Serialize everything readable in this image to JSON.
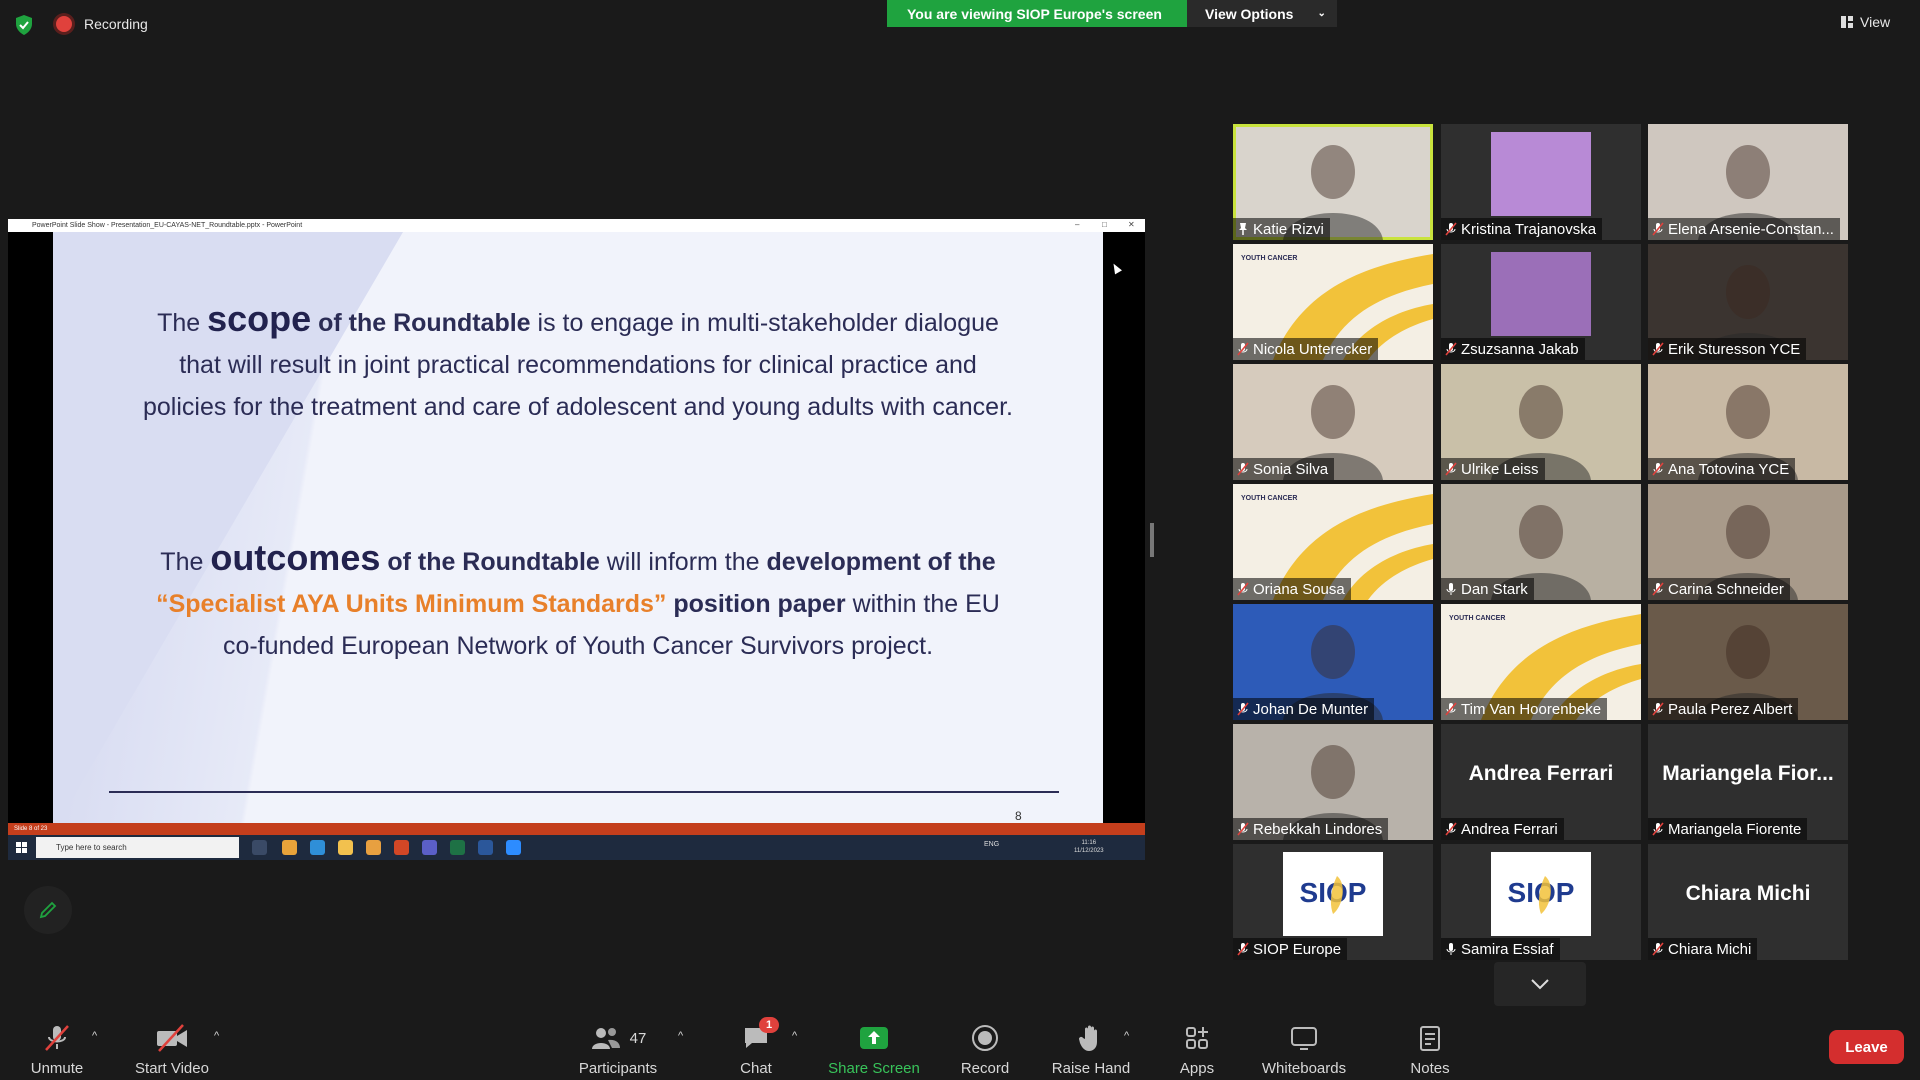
{
  "topbar": {
    "recording_label": "Recording",
    "share_banner": "You are viewing SIOP Europe's screen",
    "view_options": "View Options",
    "view_label": "View"
  },
  "shared_screen": {
    "window_title": "PowerPoint Slide Show  -  Presentation_EU-CAYAS-NET_Roundtable.pptx  -  PowerPoint",
    "status_bar": "Slide 8 of 23",
    "taskbar_search_placeholder": "Type here to search",
    "tray_lang": "ENG",
    "clock_time": "11:16",
    "clock_date": "11/12/2023",
    "slide": {
      "p1_a": "The ",
      "p1_big": "scope",
      "p1_b": " of the Roundtable",
      "p1_c": " is to engage in multi-stakeholder dialogue that will result in joint practical recommendations for clinical practice and policies for the treatment and care of adolescent and young adults with cancer.",
      "p2_a": "The ",
      "p2_big": "outcomes",
      "p2_b": " of the Roundtable",
      "p2_c": " will inform the ",
      "p2_d": "development of the",
      "p2_orange": "“Specialist AYA Units Minimum Standards”",
      "p2_e": " position paper",
      "p2_f": " within the EU co-funded European Network of Youth Cancer Survivors project.",
      "page_number": "8"
    }
  },
  "participants_gallery": [
    {
      "name": "Katie Rizvi",
      "bg": "#d9d4cc",
      "active": true,
      "muted": false
    },
    {
      "name": "Kristina Trajanovska",
      "bg": "#2f2f2f",
      "thumb": "#b88ad6",
      "muted": true
    },
    {
      "name": "Elena Arsenie-Constan...",
      "bg": "#cfc7bf",
      "muted": true
    },
    {
      "name": "Nicola Unterecker",
      "bg": "#f4efe4",
      "siop": true,
      "muted": true
    },
    {
      "name": "Zsuzsanna Jakab",
      "bg": "#2f2f2f",
      "thumb": "#9b6fb8",
      "muted": true
    },
    {
      "name": "Erik Sturesson YCE",
      "bg": "#3b3430",
      "muted": true
    },
    {
      "name": "Sonia Silva",
      "bg": "#d6cbbd",
      "muted": true
    },
    {
      "name": "Ulrike Leiss",
      "bg": "#c9c0a8",
      "muted": true
    },
    {
      "name": "Ana Totovina YCE",
      "bg": "#c8b9a4",
      "muted": true
    },
    {
      "name": "Oriana Sousa",
      "bg": "#f4efe4",
      "siop": true,
      "muted": true
    },
    {
      "name": "Dan Stark",
      "bg": "#b8b0a2",
      "muted": false
    },
    {
      "name": "Carina Schneider",
      "bg": "#a89a8a",
      "muted": true
    },
    {
      "name": "Johan De Munter",
      "bg": "#2d5bb8",
      "muted": true
    },
    {
      "name": "Tim Van Hoorenbeke",
      "bg": "#f4efe4",
      "siop": true,
      "muted": true
    },
    {
      "name": "Paula Perez Albert",
      "bg": "#6a5a4a",
      "muted": true
    },
    {
      "name": "Rebekkah Lindores",
      "bg": "#b8b2aa",
      "muted": true
    },
    {
      "name": "Andrea Ferrari",
      "bg": "#2f2f2f",
      "display_name": "Andrea Ferrari",
      "muted": true
    },
    {
      "name": "Mariangela Fiorente",
      "bg": "#2f2f2f",
      "display_name": "Mariangela  Fior...",
      "muted": true
    },
    {
      "name": "SIOP Europe",
      "bg": "#2f2f2f",
      "logo": true,
      "muted": true
    },
    {
      "name": "Samira Essiaf",
      "bg": "#2f2f2f",
      "logo": true,
      "muted": false
    },
    {
      "name": "Chiara Michi",
      "bg": "#2f2f2f",
      "display_name": "Chiara Michi",
      "muted": true
    }
  ],
  "toolbar": {
    "unmute": "Unmute",
    "start_video": "Start Video",
    "participants": "Participants",
    "participants_count": "47",
    "chat": "Chat",
    "chat_badge": "1",
    "share_screen": "Share Screen",
    "record": "Record",
    "raise_hand": "Raise Hand",
    "apps": "Apps",
    "whiteboards": "Whiteboards",
    "notes": "Notes",
    "leave": "Leave"
  },
  "colors": {
    "share_green": "#1fa33f",
    "leave_red": "#d42e2e",
    "active_speaker": "#c9e33d",
    "slide_navy": "#2b2c55",
    "slide_orange": "#e8802a"
  }
}
